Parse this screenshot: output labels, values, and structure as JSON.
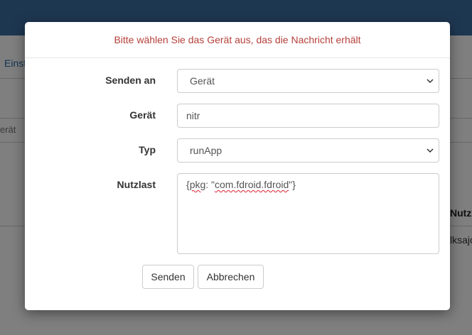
{
  "background": {
    "link_text": "Einst",
    "left_text": "erät",
    "right_header": "Nutz",
    "right_cell": "lksajo"
  },
  "modal": {
    "title": "Bitte wählen Sie das Gerät aus, das die Nachricht erhält",
    "fields": {
      "send_to": {
        "label": "Senden an",
        "value": "Gerät"
      },
      "device": {
        "label": "Gerät",
        "value": "nitr"
      },
      "type": {
        "label": "Typ",
        "value": "runApp"
      },
      "payload": {
        "label": "Nutzlast",
        "parts": [
          "{",
          "pkg",
          ": \"",
          "com.fdroid.fdroid",
          "\"}"
        ]
      }
    },
    "buttons": {
      "send": "Senden",
      "cancel": "Abbrechen"
    }
  },
  "colors": {
    "title": "#b5403a",
    "topbar": "#3c6fa3"
  },
  "icons": {
    "select_arrow": "chevron-down-icon"
  }
}
